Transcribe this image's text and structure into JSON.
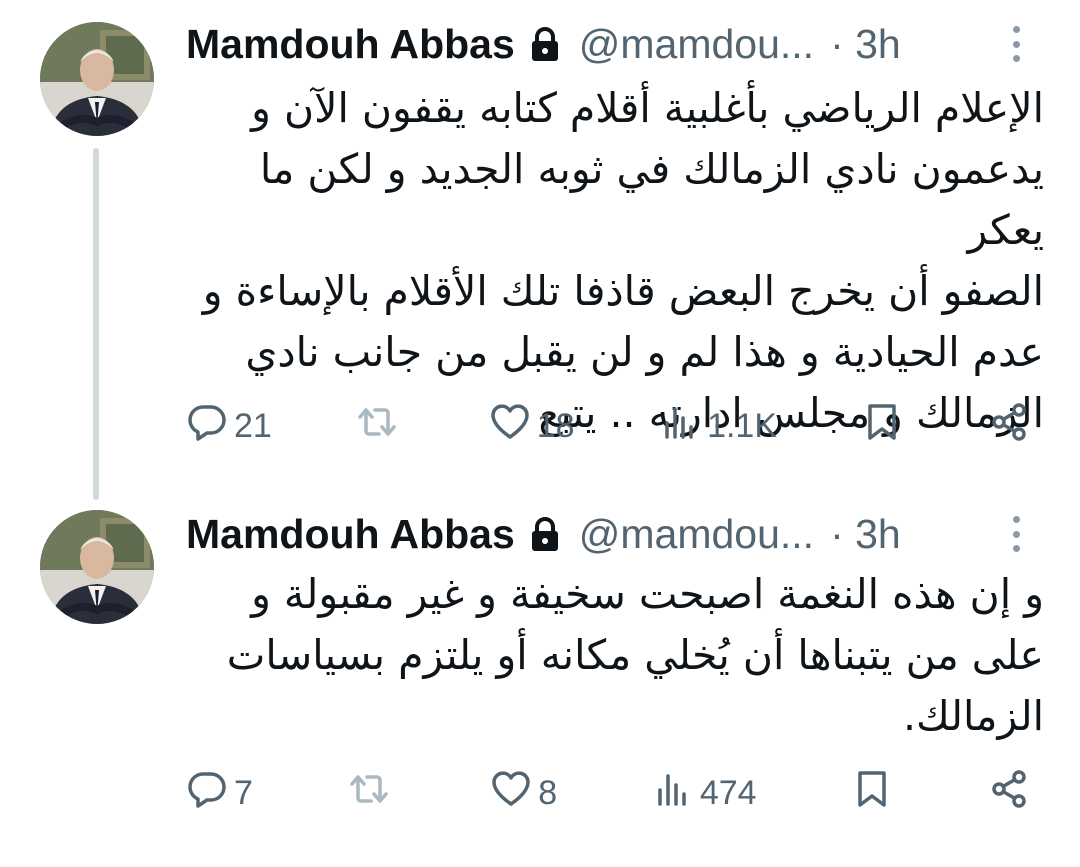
{
  "tweets": [
    {
      "author_name": "Mamdouh Abbas",
      "handle": "@mamdou...",
      "time": "· 3h",
      "text_lines": [
        "الإعلام الرياضي بأغلبية أقلام كتابه يقفون الآن و",
        "يدعمون نادي الزمالك في ثوبه الجديد و لكن ما يعكر",
        "الصفو أن يخرج البعض قاذفا تلك الأقلام بالإساءة و",
        "عدم الحيادية و هذا لم و لن يقبل من جانب نادي",
        "الزمالك و مجلس ادارته .. يتبع"
      ],
      "replies": "21",
      "reposts": "",
      "likes": "18",
      "views": "1.1K"
    },
    {
      "author_name": "Mamdouh Abbas",
      "handle": "@mamdou...",
      "time": "· 3h",
      "text_lines": [
        "و إن هذه النغمة اصبحت سخيفة و غير مقبولة و",
        "على من يتبناها أن يُخلي مكانه أو يلتزم بسياسات",
        "الزمالك."
      ],
      "replies": "7",
      "reposts": "",
      "likes": "8",
      "views": "474"
    }
  ],
  "icons": {
    "protected": "lock-icon",
    "more": "more-vertical-icon",
    "reply": "reply-bubble-icon",
    "repost": "repost-icon",
    "like": "heart-icon",
    "views": "views-bars-icon",
    "bookmark": "bookmark-icon",
    "share": "share-icon"
  },
  "colors": {
    "text_primary": "#0f1419",
    "text_secondary": "#536471",
    "thread_line": "#cfd9de",
    "repost_icon": "#aab8c2"
  }
}
